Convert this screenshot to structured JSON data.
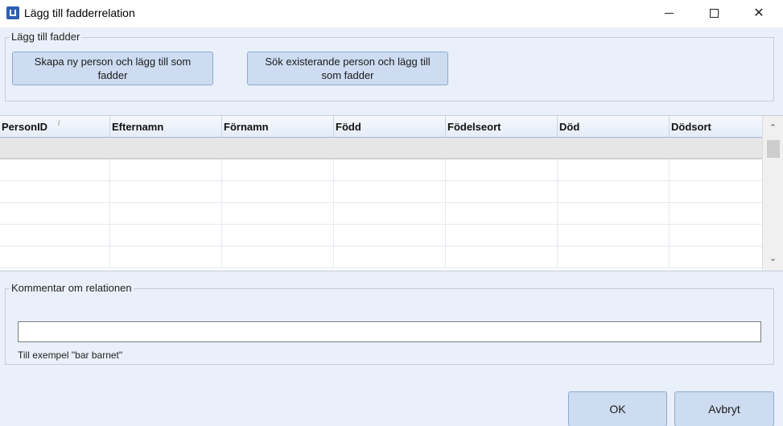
{
  "window": {
    "title": "Lägg till fadderrelation",
    "minimize_glyph": "—",
    "close_glyph": "✕"
  },
  "add_group": {
    "title": "Lägg till fadder",
    "create_button_line1": "Skapa ny person och lägg till som",
    "create_button_line2": "fadder",
    "search_button_line1": "Sök existerande person och lägg till",
    "search_button_line2": "som fadder"
  },
  "grid": {
    "columns": [
      "PersonID",
      "Efternamn",
      "Förnamn",
      "Född",
      "Födelseort",
      "Död",
      "Dödsort"
    ],
    "sort_indicator": "/",
    "rows": [
      [],
      [],
      [],
      [],
      [],
      []
    ],
    "scroll_up_glyph": "⌃",
    "scroll_down_glyph": "⌄"
  },
  "comment_group": {
    "title": "Kommentar om relationen",
    "value": "",
    "hint": "Till exempel \"bar barnet\""
  },
  "dialog": {
    "ok_label": "OK",
    "cancel_label": "Avbryt"
  }
}
